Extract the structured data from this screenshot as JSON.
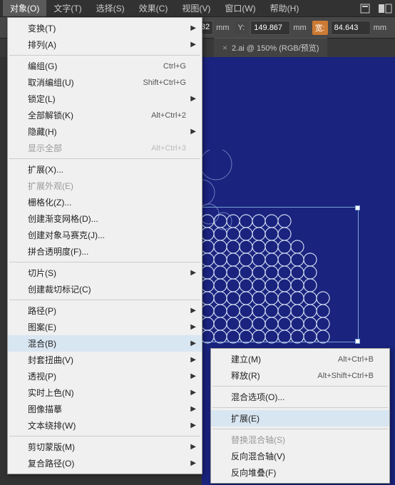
{
  "menubar": {
    "items": [
      "对象(O)",
      "文字(T)",
      "选择(S)",
      "效果(C)",
      "视图(V)",
      "窗口(W)",
      "帮助(H)"
    ]
  },
  "controlbar": {
    "x_suffix": "32",
    "y_label": "Y:",
    "y_value": "149.867",
    "w_label": "宽:",
    "w_value": "84.643",
    "unit": "mm"
  },
  "tab": {
    "title": "2.ai @ 150% (RGB/预览)",
    "close": "×"
  },
  "main_menu": [
    {
      "t": "item",
      "label": "变换(T)",
      "arrow": true
    },
    {
      "t": "item",
      "label": "排列(A)",
      "arrow": true
    },
    {
      "t": "sep"
    },
    {
      "t": "item",
      "label": "编组(G)",
      "shortcut": "Ctrl+G"
    },
    {
      "t": "item",
      "label": "取消编组(U)",
      "shortcut": "Shift+Ctrl+G"
    },
    {
      "t": "item",
      "label": "锁定(L)",
      "arrow": true
    },
    {
      "t": "item",
      "label": "全部解锁(K)",
      "shortcut": "Alt+Ctrl+2"
    },
    {
      "t": "item",
      "label": "隐藏(H)",
      "arrow": true
    },
    {
      "t": "item",
      "label": "显示全部",
      "shortcut": "Alt+Ctrl+3",
      "disabled": true
    },
    {
      "t": "sep"
    },
    {
      "t": "item",
      "label": "扩展(X)..."
    },
    {
      "t": "item",
      "label": "扩展外观(E)",
      "disabled": true
    },
    {
      "t": "item",
      "label": "栅格化(Z)..."
    },
    {
      "t": "item",
      "label": "创建渐变网格(D)..."
    },
    {
      "t": "item",
      "label": "创建对象马赛克(J)..."
    },
    {
      "t": "item",
      "label": "拼合透明度(F)..."
    },
    {
      "t": "sep"
    },
    {
      "t": "item",
      "label": "切片(S)",
      "arrow": true
    },
    {
      "t": "item",
      "label": "创建裁切标记(C)"
    },
    {
      "t": "sep"
    },
    {
      "t": "item",
      "label": "路径(P)",
      "arrow": true
    },
    {
      "t": "item",
      "label": "图案(E)",
      "arrow": true
    },
    {
      "t": "item",
      "label": "混合(B)",
      "arrow": true,
      "hl": true
    },
    {
      "t": "item",
      "label": "封套扭曲(V)",
      "arrow": true
    },
    {
      "t": "item",
      "label": "透视(P)",
      "arrow": true
    },
    {
      "t": "item",
      "label": "实时上色(N)",
      "arrow": true
    },
    {
      "t": "item",
      "label": "图像描摹",
      "arrow": true
    },
    {
      "t": "item",
      "label": "文本绕排(W)",
      "arrow": true
    },
    {
      "t": "sep"
    },
    {
      "t": "item",
      "label": "剪切蒙版(M)",
      "arrow": true
    },
    {
      "t": "item",
      "label": "复合路径(O)",
      "arrow": true
    }
  ],
  "submenu": [
    {
      "t": "item",
      "label": "建立(M)",
      "shortcut": "Alt+Ctrl+B"
    },
    {
      "t": "item",
      "label": "释放(R)",
      "shortcut": "Alt+Shift+Ctrl+B"
    },
    {
      "t": "sep"
    },
    {
      "t": "item",
      "label": "混合选项(O)..."
    },
    {
      "t": "sep"
    },
    {
      "t": "item",
      "label": "扩展(E)",
      "hl": true
    },
    {
      "t": "sep"
    },
    {
      "t": "item",
      "label": "替换混合轴(S)",
      "disabled": true
    },
    {
      "t": "item",
      "label": "反向混合轴(V)"
    },
    {
      "t": "item",
      "label": "反向堆叠(F)"
    }
  ]
}
